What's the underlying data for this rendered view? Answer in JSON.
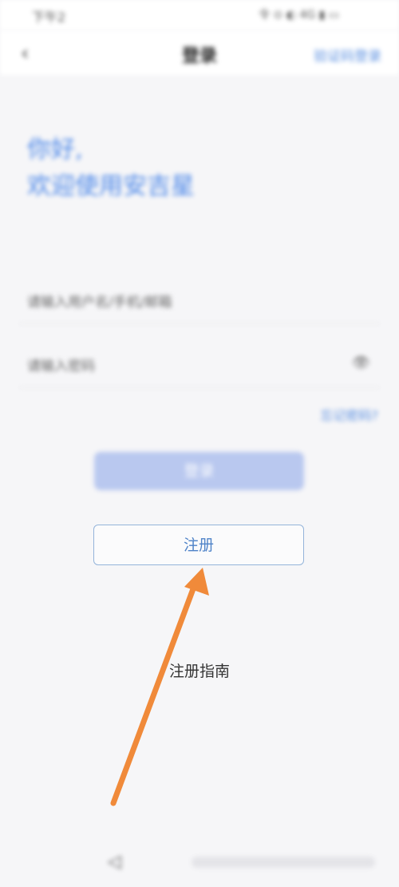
{
  "status_bar": {
    "left_text": "下午2",
    "right_text": "令 ⊙ ◐ 4G ▮ ▭"
  },
  "nav": {
    "back_glyph": "‹",
    "title": "登录",
    "action": "验证码登录"
  },
  "greeting": {
    "line1": "你好,",
    "line2": "欢迎使用安吉星"
  },
  "form": {
    "account_placeholder": "请输入用户名/手机/邮箱",
    "password_placeholder": "请输入密码",
    "eye_glyph": "👁",
    "forgot": "忘记密码?"
  },
  "buttons": {
    "login": "登录",
    "register": "注册",
    "guide": "注册指南"
  },
  "bottom_nav": {
    "back_glyph": "◁"
  },
  "colors": {
    "accent": "#4a86e8",
    "arrow": "#f08a3a"
  }
}
